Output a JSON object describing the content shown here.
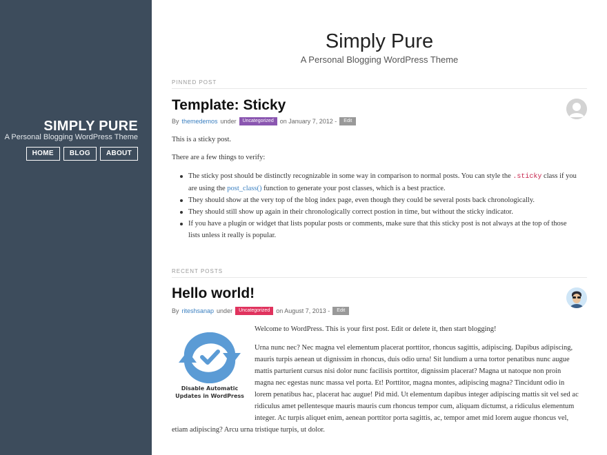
{
  "sidebar": {
    "title": "SIMPLY PURE",
    "tagline": "A Personal Blogging WordPress Theme",
    "nav": [
      "HOME",
      "BLOG",
      "ABOUT"
    ]
  },
  "header": {
    "title": "Simply Pure",
    "tagline": "A Personal Blogging WordPress Theme"
  },
  "pinned": {
    "label": "PINNED POST",
    "title": "Template: Sticky",
    "meta_by": "By",
    "author": "themedemos",
    "meta_under": "under",
    "category": "Uncategorized",
    "meta_date": "on January 7, 2012 -",
    "edit": "Edit",
    "intro": "This is a sticky post.",
    "subintro": "There are a few things to verify:",
    "bullet1_a": "The sticky post should be distinctly recognizable in some way in comparison to normal posts. You can style the",
    "bullet1_code": ".sticky",
    "bullet1_b": "class if you",
    "bullet1_c": "are using the",
    "bullet1_link": "post_class()",
    "bullet1_d": "function to generate your post classes, which is a best practice.",
    "bullet2": "They should show at the very top of the blog index page, even though they could be several posts back chronologically.",
    "bullet3": "They should still show up again in their chronologically correct postion in time, but without the sticky indicator.",
    "bullet4a": "If you have a plugin or widget that lists popular posts or comments, make sure that this sticky post is not always at the top of those",
    "bullet4b": "lists unless it really is popular."
  },
  "recent": {
    "label": "RECENT POSTS",
    "title": "Hello world!",
    "meta_by": "By",
    "author": "riteshsanap",
    "meta_under": "under",
    "category": "Uncategorized",
    "meta_date": "on August 7, 2013 -",
    "edit": "Edit",
    "featured_caption_1": "Disable Automatic",
    "featured_caption_2": "Updates in WordPress",
    "welcome": "Welcome to WordPress. This is your first post. Edit or delete it, then start blogging!",
    "lines": [
      "Urna nunc nec? Nec magna vel elementum placerat porttitor, rhoncus sagittis, adipiscing. Dapibus adipiscing,",
      "mauris turpis aenean ut dignissim in rhoncus, duis odio urna! Sit lundium a urna tortor penatibus nunc augue",
      "mattis parturient cursus nisi dolor nunc facilisis porttitor, dignissim placerat? Magna ut natoque non proin",
      "magna nec egestas nunc massa vel porta. Et! Porttitor, magna montes, adipiscing magna? Tincidunt odio in",
      "lorem penatibus hac, placerat hac augue! Pid mid. Ut elementum dapibus integer adipiscing mattis sit vel sed ac",
      "ridiculus amet pellentesque mauris mauris cum rhoncus tempor cum, aliquam dictumst, a ridiculus elementum",
      "integer. Ac turpis aliquet enim, aenean porttitor porta sagittis, ac, tempor amet mid lorem augue rhoncus vel,"
    ],
    "last_line": "etiam adipiscing? Arcu urna tristique turpis, ut dolor."
  },
  "colors": {
    "sidebar_bg": "#3d4c5c",
    "link": "#3a7fc0",
    "badge_purple": "#8a56b0",
    "badge_red": "#e0335e",
    "featured_icon": "#5b9bd5"
  }
}
